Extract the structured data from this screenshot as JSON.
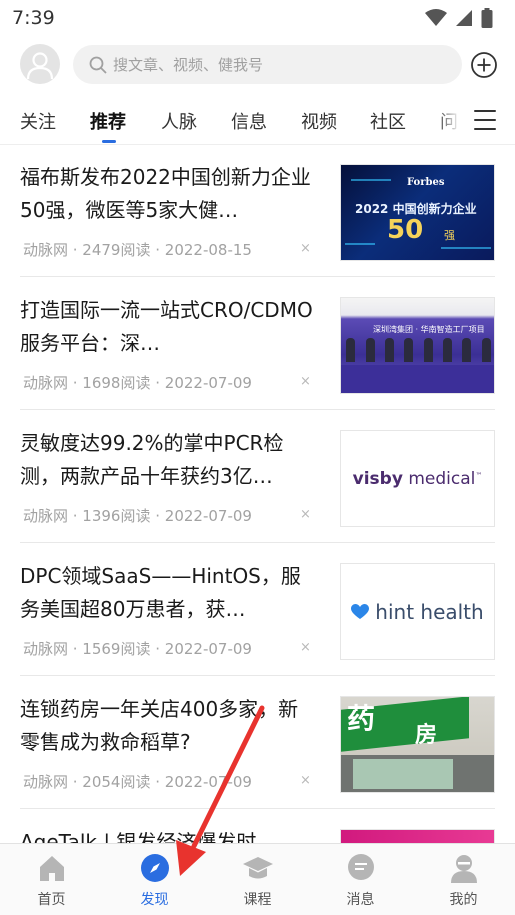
{
  "status_bar": {
    "time": "7:39"
  },
  "search": {
    "placeholder": "搜文章、视频、健我号"
  },
  "tabs": [
    {
      "label": "关注",
      "active": false
    },
    {
      "label": "推荐",
      "active": true
    },
    {
      "label": "人脉",
      "active": false
    },
    {
      "label": "信息",
      "active": false
    },
    {
      "label": "视频",
      "active": false
    },
    {
      "label": "社区",
      "active": false
    },
    {
      "label": "问",
      "active": false
    }
  ],
  "articles": [
    {
      "title": "福布斯发布2022中国创新力企业50强，微医等5家大健…",
      "meta": "动脉网 · 2479阅读 · 2022-08-15",
      "thumb": {
        "brand": "Forbes",
        "line1": "2022 中国创新力企业",
        "number": "50",
        "suffix": "强"
      }
    },
    {
      "title": "打造国际一流一站式CRO/CDMO服务平台：深…",
      "meta": "动脉网 · 1698阅读 · 2022-07-09",
      "thumb": {
        "banner": "深圳湾集团 · 华南智造工厂项目"
      }
    },
    {
      "title": "灵敏度达99.2%的掌中PCR检测，两款产品十年获约3亿…",
      "meta": "动脉网 · 1396阅读 · 2022-07-09",
      "thumb": {
        "logo_bold": "visby",
        "logo_light": " medical",
        "tm": "™"
      }
    },
    {
      "title": "DPC领域SaaS——HintOS，服务美国超80万患者，获…",
      "meta": "动脉网 · 1569阅读 · 2022-07-09",
      "thumb": {
        "logo": "hint health"
      }
    },
    {
      "title": "连锁药房一年关店400多家，新零售成为救命稻草?",
      "meta": "动脉网 · 2054阅读 · 2022-07-09",
      "thumb": {
        "sign1": "药",
        "sign2": "房"
      }
    },
    {
      "title": "AgeTalk | 银发经济爆发时",
      "meta": "",
      "thumb": {}
    }
  ],
  "close_glyph": "×",
  "bottom_nav": [
    {
      "label": "首页",
      "icon": "home-icon",
      "active": false
    },
    {
      "label": "发现",
      "icon": "compass-icon",
      "active": true
    },
    {
      "label": "课程",
      "icon": "graduation-cap-icon",
      "active": false
    },
    {
      "label": "消息",
      "icon": "message-icon",
      "active": false
    },
    {
      "label": "我的",
      "icon": "profile-icon",
      "active": false
    }
  ],
  "colors": {
    "accent": "#2a6de0",
    "annotation_arrow": "#e8332e"
  }
}
